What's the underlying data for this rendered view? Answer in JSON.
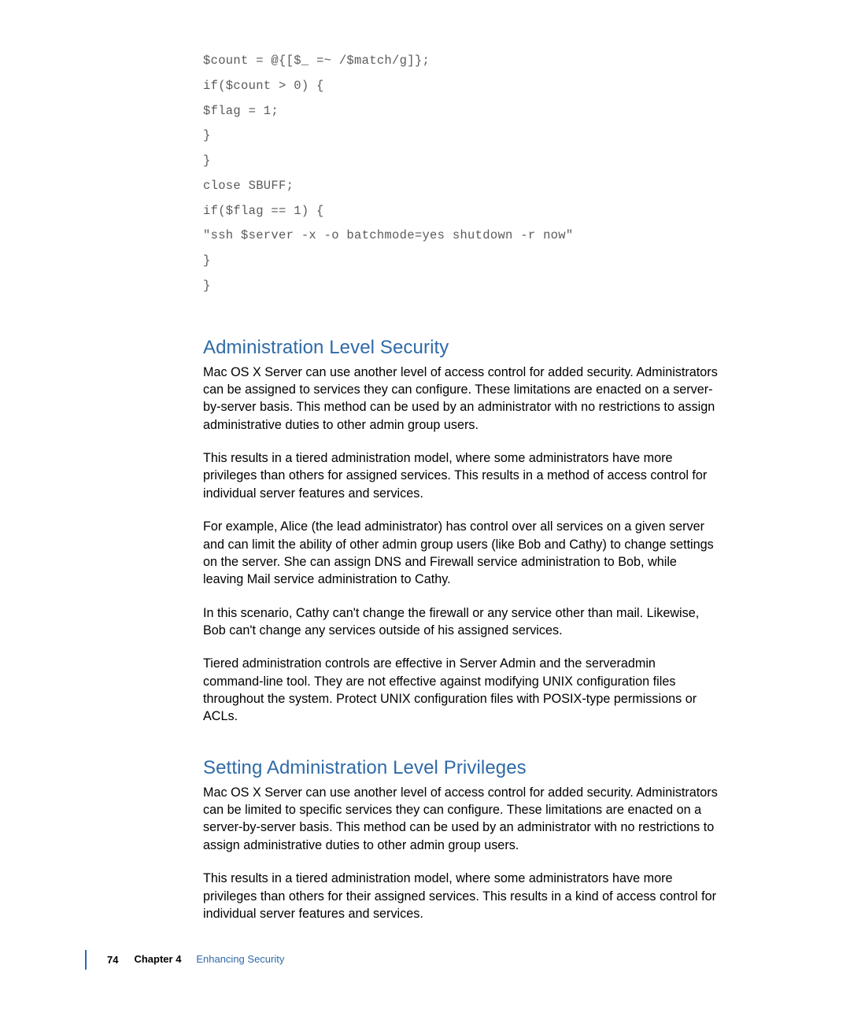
{
  "code": {
    "lines": [
      "$count = @{[$_ =~ /$match/g]};",
      "if($count > 0) {",
      "$flag = 1;",
      "}",
      "}",
      "close SBUFF;",
      "if($flag == 1) {",
      "\"ssh $server -x -o batchmode=yes shutdown -r now\"",
      "}",
      "}"
    ]
  },
  "section1": {
    "heading": "Administration Level Security",
    "p1": "Mac OS X Server can use another level of access control for added security. Administrators can be assigned to services they can configure. These limitations are enacted on a server-by-server basis. This method can be used by an administrator with no restrictions to assign administrative duties to other admin group users.",
    "p2": "This results in a tiered administration model, where some administrators have more privileges than others for assigned services. This results in a method of access control for individual server features and services.",
    "p3": "For example, Alice (the lead administrator) has control over all services on a given server and can limit the ability of other admin group users (like Bob and Cathy) to change settings on the server. She can assign DNS and Firewall service administration to Bob, while leaving Mail service administration to Cathy.",
    "p4": "In this scenario, Cathy can't change the firewall or any service other than mail. Likewise, Bob can't change any services outside of his assigned services.",
    "p5": "Tiered administration controls are effective in Server Admin and the serveradmin command-line tool. They are not effective against modifying UNIX configuration files throughout the system. Protect UNIX configuration files with POSIX-type permissions or ACLs."
  },
  "section2": {
    "heading": "Setting Administration Level Privileges",
    "p1": "Mac OS X Server can use another level of access control for added security. Administrators can be limited to specific services they can configure. These limitations are enacted on a server-by-server basis. This method can be used by an administrator with no restrictions to assign administrative duties to other admin group users.",
    "p2": "This results in a tiered administration model, where some administrators have more privileges than others for their assigned services. This results in a kind of access control for individual server features and services."
  },
  "footer": {
    "page": "74",
    "chapter_label": "Chapter 4",
    "chapter_title": "Enhancing Security"
  }
}
